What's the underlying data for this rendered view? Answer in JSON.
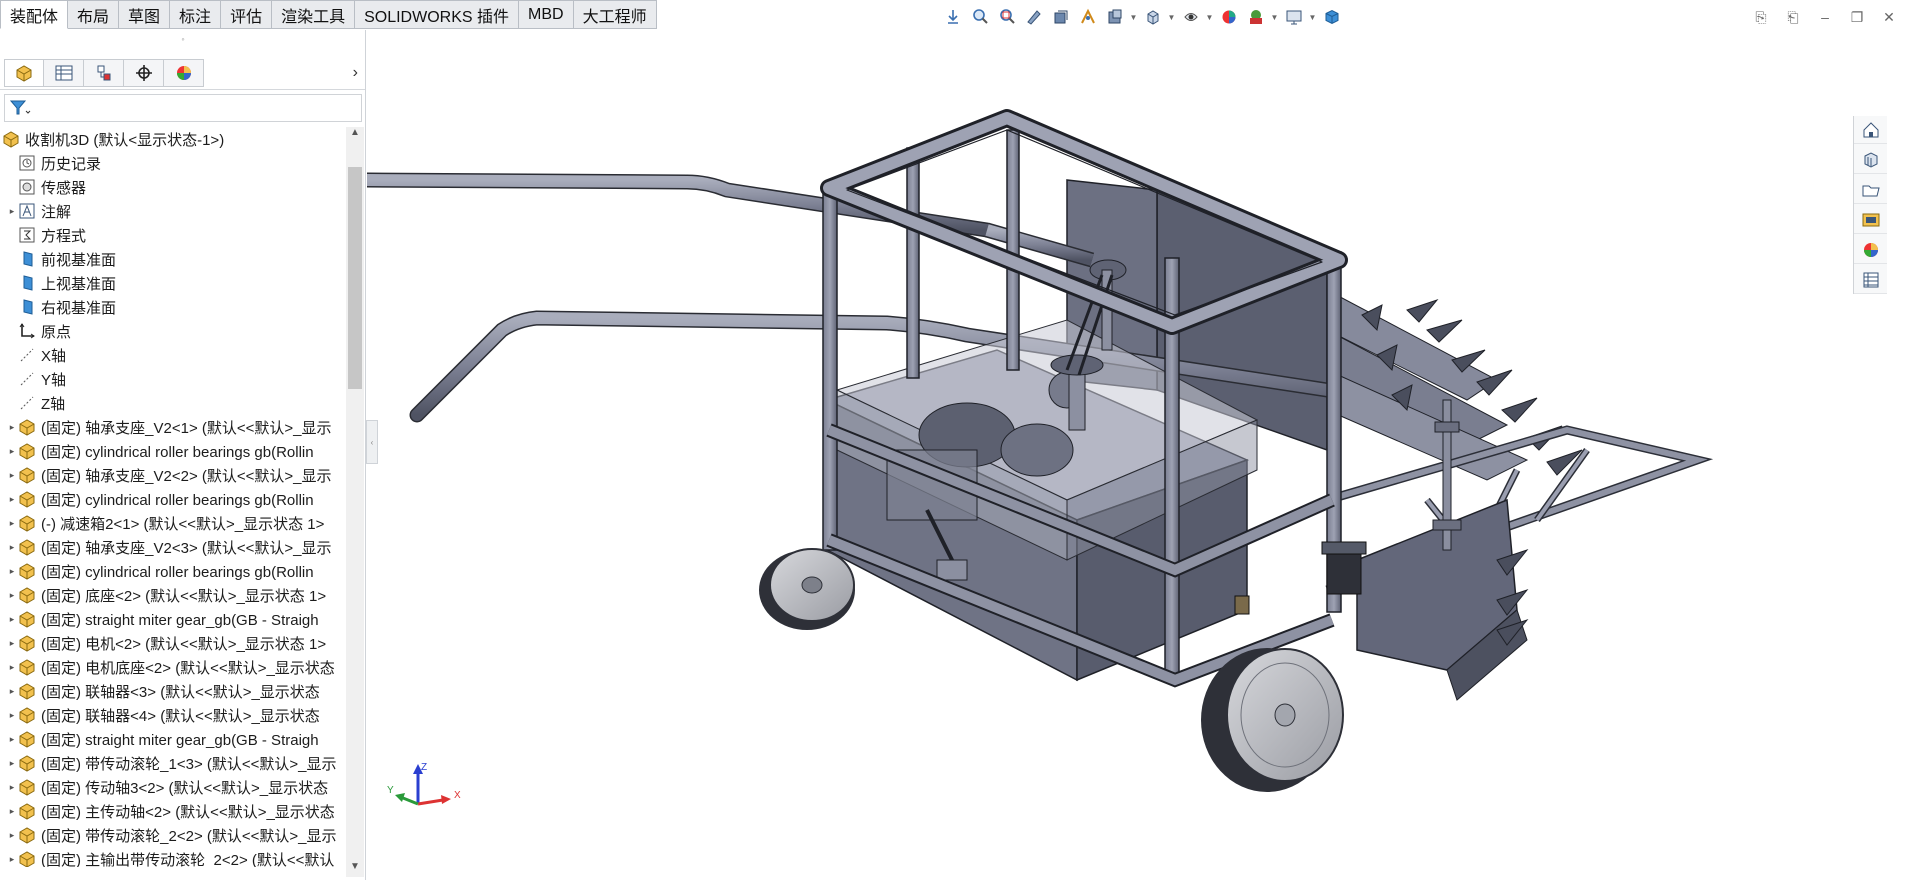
{
  "command_tabs": [
    "装配体",
    "布局",
    "草图",
    "标注",
    "评估",
    "渲染工具",
    "SOLIDWORKS 插件",
    "MBD",
    "大工程师"
  ],
  "active_tab": "装配体",
  "hud_icons": [
    "view-orientation-icon",
    "zoom-to-fit-icon",
    "zoom-to-area-icon",
    "previous-view-icon",
    "section-view-icon",
    "dynamic-annotation-icon",
    "view-settings-icon",
    "view-orientation-dropdown-icon",
    "display-style-icon",
    "hide-show-items-icon",
    "edit-appearance-icon",
    "apply-scene-icon",
    "view-settings-monitor-icon",
    "cube-icon"
  ],
  "feature_tabs": [
    "featuremanager-icon",
    "propertymanager-icon",
    "configurationmanager-icon",
    "dimxpert-icon",
    "displaymanager-icon"
  ],
  "tree": {
    "root": "收割机3D  (默认<显示状态-1>)",
    "items": [
      {
        "label": "历史记录",
        "icon": "history-icon",
        "expander": false
      },
      {
        "label": "传感器",
        "icon": "sensor-icon",
        "expander": false
      },
      {
        "label": "注解",
        "icon": "annotation-icon",
        "expander": true
      },
      {
        "label": "方程式",
        "icon": "equation-icon",
        "expander": false
      },
      {
        "label": "前视基准面",
        "icon": "plane-icon",
        "expander": false
      },
      {
        "label": "上视基准面",
        "icon": "plane-icon",
        "expander": false
      },
      {
        "label": "右视基准面",
        "icon": "plane-icon",
        "expander": false
      },
      {
        "label": "原点",
        "icon": "origin-icon",
        "expander": false
      },
      {
        "label": "X轴",
        "icon": "axis-icon",
        "expander": false
      },
      {
        "label": "Y轴",
        "icon": "axis-icon",
        "expander": false
      },
      {
        "label": "Z轴",
        "icon": "axis-icon",
        "expander": false
      },
      {
        "label": "(固定) 轴承支座_V2<1> (默认<<默认>_显示",
        "icon": "part-icon",
        "expander": true
      },
      {
        "label": "(固定) cylindrical roller bearings gb(Rollin",
        "icon": "part-icon",
        "expander": true
      },
      {
        "label": "(固定) 轴承支座_V2<2> (默认<<默认>_显示",
        "icon": "part-icon",
        "expander": true
      },
      {
        "label": "(固定) cylindrical roller bearings gb(Rollin",
        "icon": "part-icon",
        "expander": true
      },
      {
        "label": "(-) 减速箱2<1> (默认<<默认>_显示状态 1>",
        "icon": "part-icon",
        "expander": true
      },
      {
        "label": "(固定) 轴承支座_V2<3> (默认<<默认>_显示",
        "icon": "part-icon",
        "expander": true
      },
      {
        "label": "(固定) cylindrical roller bearings gb(Rollin",
        "icon": "part-icon",
        "expander": true
      },
      {
        "label": "(固定) 底座<2> (默认<<默认>_显示状态 1>",
        "icon": "part-icon",
        "expander": true
      },
      {
        "label": "(固定) straight miter gear_gb(GB - Straigh",
        "icon": "part-icon",
        "expander": true
      },
      {
        "label": "(固定) 电机<2> (默认<<默认>_显示状态 1>",
        "icon": "part-icon",
        "expander": true
      },
      {
        "label": "(固定) 电机底座<2> (默认<<默认>_显示状态",
        "icon": "part-icon",
        "expander": true
      },
      {
        "label": "(固定) 联轴器<3> (默认<<默认>_显示状态",
        "icon": "part-icon",
        "expander": true
      },
      {
        "label": "(固定) 联轴器<4> (默认<<默认>_显示状态",
        "icon": "part-icon",
        "expander": true
      },
      {
        "label": "(固定) straight miter gear_gb(GB - Straigh",
        "icon": "part-icon",
        "expander": true
      },
      {
        "label": "(固定) 带传动滚轮_1<3> (默认<<默认>_显示",
        "icon": "part-icon",
        "expander": true
      },
      {
        "label": "(固定) 传动轴3<2> (默认<<默认>_显示状态",
        "icon": "part-icon",
        "expander": true
      },
      {
        "label": "(固定) 主传动轴<2> (默认<<默认>_显示状态",
        "icon": "part-icon",
        "expander": true
      },
      {
        "label": "(固定) 带传动滚轮_2<2> (默认<<默认>_显示",
        "icon": "part-icon",
        "expander": true
      },
      {
        "label": "(固定) 主输出带传动滚轮_2<2> (默认<<默认",
        "icon": "part-icon",
        "expander": true
      }
    ]
  },
  "task_pane": [
    "solidworks-resources-icon",
    "design-library-icon",
    "file-explorer-icon",
    "view-palette-icon",
    "appearances-icon",
    "custom-properties-icon"
  ],
  "triad": {
    "x": "X",
    "y": "Y",
    "z": "Z"
  },
  "colors": {
    "model_fill": "#5d6170",
    "model_edge": "#2a2c33",
    "tube": "#8b8fa0",
    "panel_bg": "#ffffff"
  }
}
